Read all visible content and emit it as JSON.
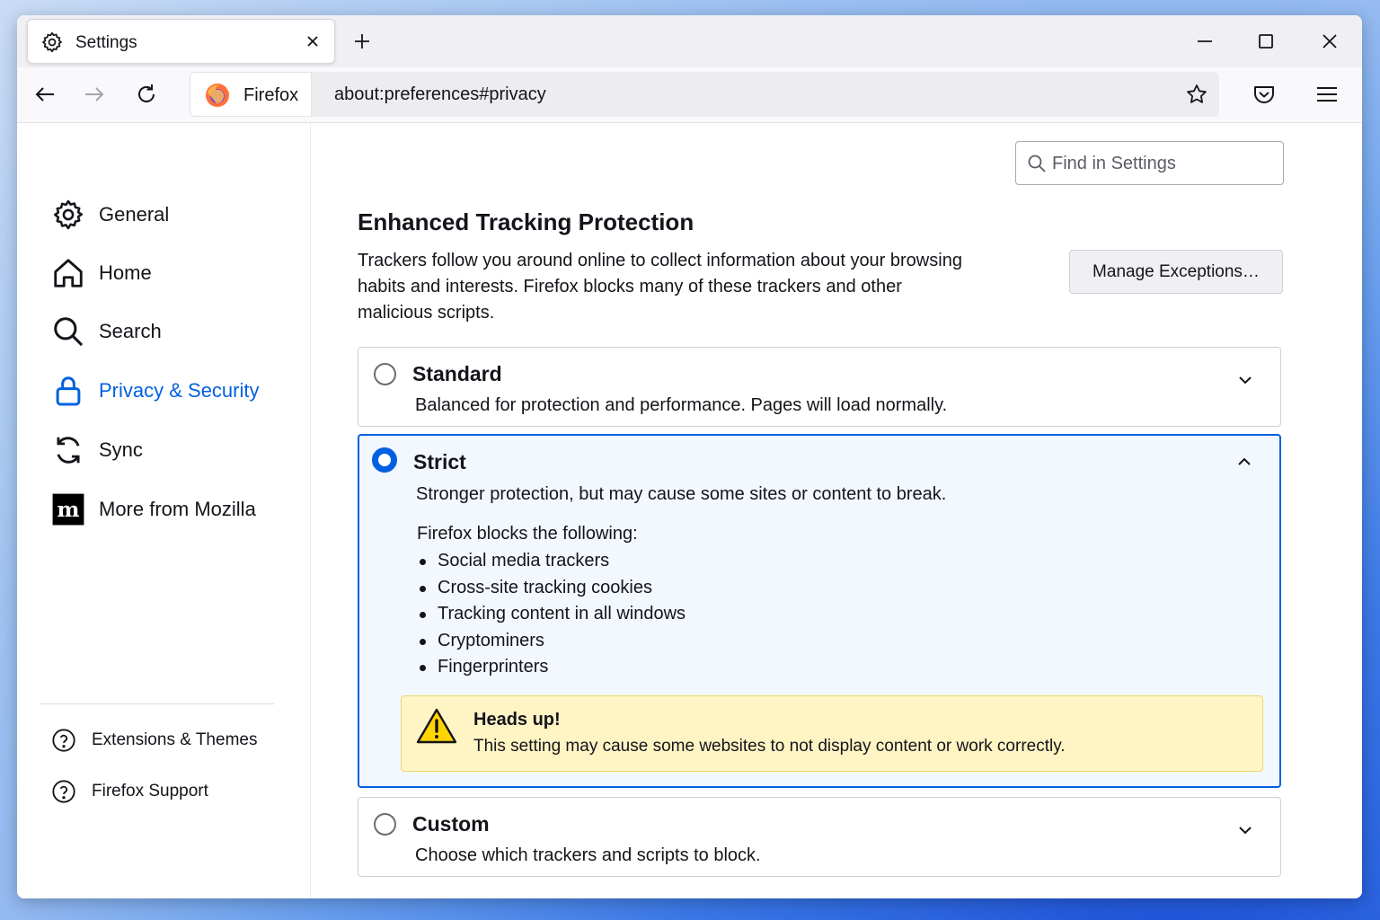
{
  "tab": {
    "title": "Settings"
  },
  "urlbar": {
    "identity": "Firefox",
    "url": "about:preferences#privacy"
  },
  "sidebar": {
    "categories": [
      {
        "label": "General",
        "icon": "gear-icon"
      },
      {
        "label": "Home",
        "icon": "home-icon"
      },
      {
        "label": "Search",
        "icon": "search-icon"
      },
      {
        "label": "Privacy & Security",
        "icon": "lock-icon",
        "selected": true
      },
      {
        "label": "Sync",
        "icon": "sync-icon"
      },
      {
        "label": "More from Mozilla",
        "icon": "mozilla-icon"
      }
    ],
    "footer": [
      {
        "label": "Extensions & Themes",
        "icon": "help-icon"
      },
      {
        "label": "Firefox Support",
        "icon": "help-icon"
      }
    ]
  },
  "search": {
    "placeholder": "Find in Settings"
  },
  "etp": {
    "title": "Enhanced Tracking Protection",
    "description": "Trackers follow you around online to collect information about your browsing habits and interests. Firefox blocks many of these trackers and other malicious scripts.",
    "manage_label": "Manage Exceptions…",
    "options": {
      "standard": {
        "title": "Standard",
        "desc": "Balanced for protection and performance. Pages will load normally."
      },
      "strict": {
        "title": "Strict",
        "desc": "Stronger protection, but may cause some sites or content to break.",
        "blocks_heading": "Firefox blocks the following:",
        "blocks": [
          "Social media trackers",
          "Cross-site tracking cookies",
          "Tracking content in all windows",
          "Cryptominers",
          "Fingerprinters"
        ],
        "warning_title": "Heads up!",
        "warning_text": "This setting may cause some websites to not display content or work correctly."
      },
      "custom": {
        "title": "Custom",
        "desc": "Choose which trackers and scripts to block."
      }
    },
    "selected": "strict"
  },
  "colors": {
    "accent": "#0061e0",
    "warning_bg": "#fff4c4"
  }
}
